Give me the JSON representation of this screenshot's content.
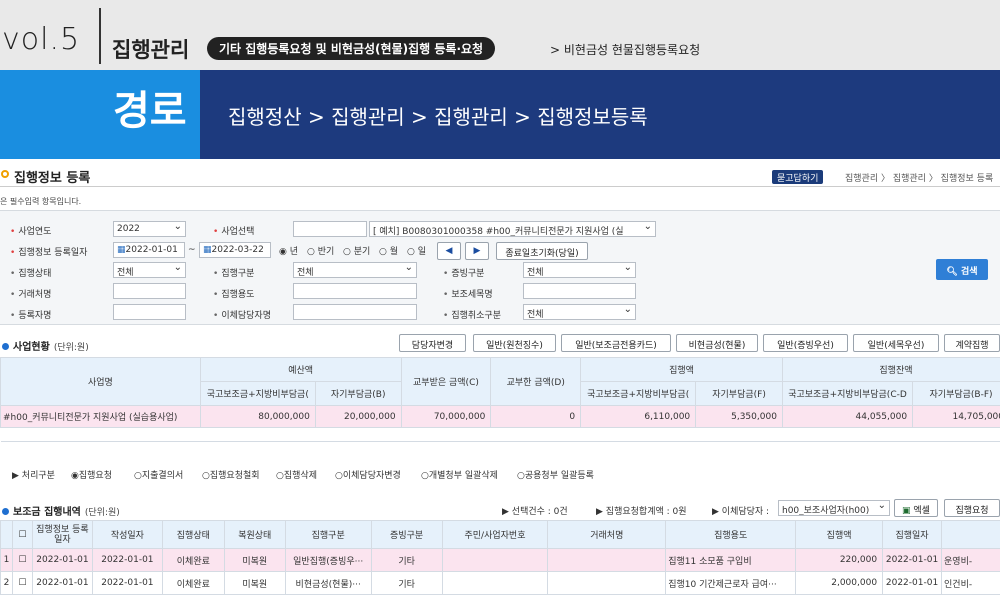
{
  "header": {
    "vol": "vol.5",
    "section": "집행관리",
    "pill": "기타 집행등록요청 및 비현금성(현물)집행 등록·요청",
    "subpath": "> 비현금성 현물집행등록요청",
    "route_label": "경로",
    "route_path": "집행정산 > 집행관리 > 집행관리 > 집행정보등록"
  },
  "page": {
    "title": "집행정보 등록",
    "qa_button": "묻고답하기",
    "breadcrumb": "집행관리 〉 집행관리 〉 집행정보 등록",
    "required_note": "은 필수입력 항목입니다."
  },
  "search": {
    "year_label": "사업연도",
    "year_value": "2022",
    "project_label": "사업선택",
    "project_value": "[  예치] B0080301000358 #h00_커뮤니티전문가 지원사업 (실",
    "reg_date_label": "집행정보 등록일자",
    "date_from": "2022-01-01",
    "tilde": "~",
    "date_to": "2022-03-22",
    "period_options": [
      "년",
      "반기",
      "분기",
      "월",
      "일"
    ],
    "period_selected": "년",
    "prev_label": "◀",
    "next_label": "▶",
    "init_btn": "종료일초기화(당일)",
    "status_label": "집행상태",
    "status_value": "전체",
    "exec_type_label": "집행구분",
    "exec_type_value": "전체",
    "proof_label": "증빙구분",
    "proof_value": "전체",
    "vendor_label": "거래처명",
    "usage_label": "집행용도",
    "subsidy_label": "보조세목명",
    "registrant_label": "등록자명",
    "transfer_mgr_label": "이체담당자명",
    "cancel_label": "집행취소구분",
    "cancel_value": "전체",
    "search_btn": "검색"
  },
  "project_status": {
    "title": "사업현황",
    "unit": "(단위:원)",
    "buttons": [
      "담당자변경",
      "일반(원천징수)",
      "일반(보조금전용카드)",
      "비현금성(현물)",
      "일반(증빙우선)",
      "일반(세목우선)",
      "계약집행"
    ],
    "headers": {
      "name": "사업명",
      "budget": "예산액",
      "budget_sub1": "국고보조금+지방비부담금(",
      "budget_sub2": "자기부담금(B)",
      "received": "교부받은 금액(C)",
      "returned": "교부한 금액(D)",
      "executed": "집행액",
      "exec_sub1": "국고보조금+지방비부담금(",
      "exec_sub2": "자기부담금(F)",
      "balance": "집행잔액",
      "bal_sub1": "국고보조금+지방비부담금(C-D",
      "bal_sub2": "자기부담금(B-F)"
    },
    "row": {
      "name": "#h00_커뮤니티전문가 지원사업 (실습용사업)",
      "b1": "80,000,000",
      "b2": "20,000,000",
      "c": "70,000,000",
      "d": "0",
      "e": "6,110,000",
      "f": "5,350,000",
      "g": "44,055,000",
      "h": "14,705,000"
    }
  },
  "process": {
    "label": "처리구분",
    "options": [
      "집행요청",
      "지출결의서",
      "집행요청철회",
      "집행삭제",
      "이체담당자변경",
      "개별청부 일괄삭제",
      "공용청부 일괄등록"
    ],
    "selected": "집행요청"
  },
  "exec_list": {
    "title": "보조금 집행내역",
    "unit": "(단위:원)",
    "selected_count": "선택건수 : 0건",
    "total_req": "집행요청합계액 : 0원",
    "transfer_mgr": "이체담당자 :",
    "transfer_value": "h00_보조사업자(h00)",
    "excel_btn": "엑셀",
    "request_btn": "집행요청",
    "columns": [
      "",
      "집행정보\n등록일자",
      "작성일자",
      "집행상태",
      "복원상태",
      "집행구분",
      "증빙구분",
      "주민/사업자번호",
      "거래처명",
      "집행용도",
      "집행액",
      "집행일자",
      ""
    ],
    "rows": [
      [
        "1",
        "2022-01-01",
        "2022-01-01",
        "이체완료",
        "미복원",
        "일반집행(증빙우···",
        "기타",
        "",
        "",
        "집행11 소모품 구입비",
        "220,000",
        "2022-01-01",
        "운영비-"
      ],
      [
        "2",
        "2022-01-01",
        "2022-01-01",
        "이체완료",
        "미복원",
        "비현금성(현물)···",
        "기타",
        "",
        "",
        "집행10 기간제근로자 급여···",
        "2,000,000",
        "2022-01-01",
        "인건비-"
      ]
    ]
  }
}
